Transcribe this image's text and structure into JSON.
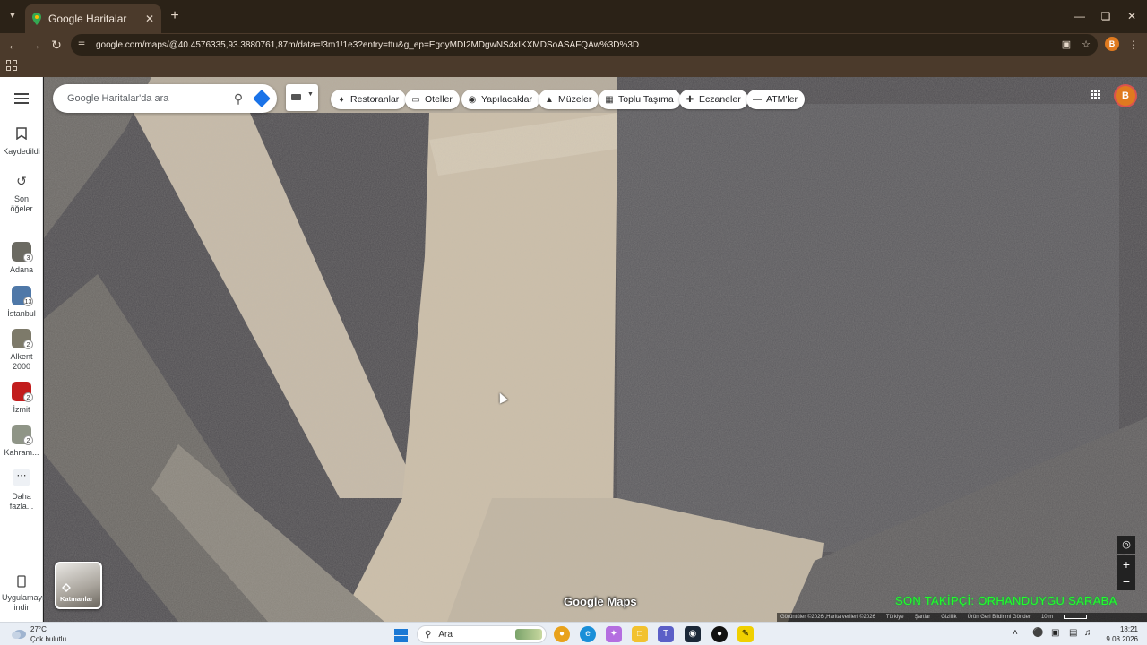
{
  "browser": {
    "tab_title": "Google Haritalar",
    "url": "google.com/maps/@40.4576335,93.3880761,87m/data=!3m1!1e3?entry=ttu&g_ep=EgoyMDI2MDgwNS4xIKXMDSoASAFQAw%3D%3D",
    "profile_initial": "B"
  },
  "maps": {
    "search_placeholder": "Google Haritalar'da ara",
    "chips": [
      {
        "label": "Restoranlar",
        "icon": "fork-knife-icon"
      },
      {
        "label": "Oteller",
        "icon": "bed-icon"
      },
      {
        "label": "Yapılacaklar",
        "icon": "camera-icon"
      },
      {
        "label": "Müzeler",
        "icon": "museum-icon"
      },
      {
        "label": "Toplu Taşıma",
        "icon": "bus-icon"
      },
      {
        "label": "Eczaneler",
        "icon": "pharmacy-icon"
      },
      {
        "label": "ATM'ler",
        "icon": "atm-icon"
      }
    ],
    "avatar_initial": "B",
    "layers_label": "Katmanlar",
    "logo": "Google Maps",
    "overlay_text": "SON TAKİPÇİ: ORHANDUYGU SARABA",
    "attribution": {
      "imagery": "Görüntüler ©2026 ,Harita verileri ©2026",
      "country": "Türkiye",
      "terms": "Şartlar",
      "privacy": "Gizlilik",
      "feedback": "Ürün Geri Bildirimi Gönder",
      "scale": "10 m"
    }
  },
  "sidebar": {
    "saved": "Kaydedildi",
    "recent": "Son öğeler",
    "places": [
      {
        "label": "Adana",
        "count": "3",
        "color": "#6b6a62"
      },
      {
        "label": "İstanbul",
        "count": "13",
        "color": "#4f78a8"
      },
      {
        "label": "Alkent 2000",
        "count": "2",
        "color": "#7d7a6a"
      },
      {
        "label": "İzmit",
        "count": "2",
        "color": "#c21d1d"
      },
      {
        "label": "Kahram...",
        "count": "2",
        "color": "#8f9587"
      }
    ],
    "more": "Daha fazla...",
    "get_app": "Uygulamayı indir"
  },
  "taskbar": {
    "temperature": "27°C",
    "weather": "Çok bulutlu",
    "search": "Ara",
    "time": "18:21",
    "date": "9.08.2026"
  },
  "colors": {
    "chrome_dark": "#2b2217",
    "chrome_light": "#4b3a2b",
    "accent_orange": "#e07a1f",
    "overlay_green": "#22ff2a",
    "maps_blue": "#1a73e8"
  }
}
